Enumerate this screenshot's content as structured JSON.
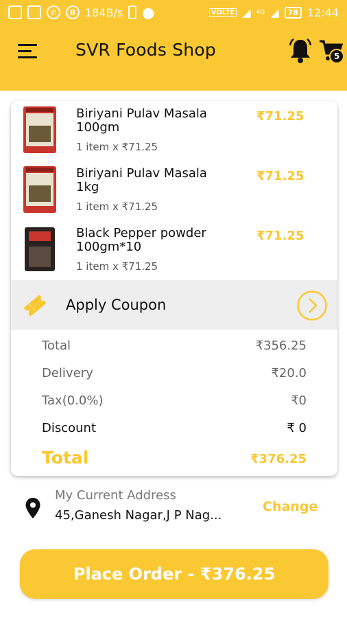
{
  "status_bar": {
    "speed": "184B/s",
    "volte": "VOLTE",
    "network": "4G",
    "battery": "78",
    "time": "12:44"
  },
  "app_bar": {
    "title": "SVR Foods Shop",
    "cart_count": "5"
  },
  "cart": {
    "items": [
      {
        "name": "Biriyani Pulav Masala 100gm",
        "qty": "1 item x ₹71.25",
        "price": "₹71.25"
      },
      {
        "name": "Biriyani Pulav Masala 1kg",
        "qty": "1 item x ₹71.25",
        "price": "₹71.25"
      },
      {
        "name": "Black Pepper powder 100gm*10",
        "qty": "1 item x ₹71.25",
        "price": "₹71.25"
      }
    ],
    "coupon_label": "Apply Coupon",
    "summary": {
      "total_label": "Total",
      "total_value": "₹356.25",
      "delivery_label": "Delivery",
      "delivery_value": "₹20.0",
      "tax_label": "Tax(0.0%)",
      "tax_value": "₹0",
      "discount_label": "Discount",
      "discount_value": "₹ 0",
      "grand_label": "Total",
      "grand_value": "₹376.25"
    }
  },
  "address": {
    "label": "My Current Address",
    "text": "45,Ganesh Nagar,J P Nag...",
    "change_label": "Change"
  },
  "place_order_label": "Place Order - ₹376.25",
  "colors": {
    "accent": "#f9c832",
    "text": "#111111"
  }
}
